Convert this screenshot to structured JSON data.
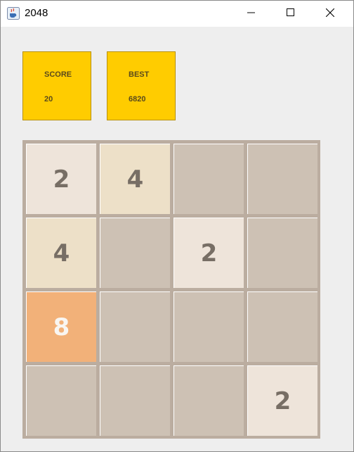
{
  "window": {
    "title": "2048"
  },
  "scores": [
    {
      "label": "SCORE",
      "value": "20"
    },
    {
      "label": "BEST",
      "value": "6820"
    }
  ],
  "board": {
    "rows": 4,
    "cols": 4,
    "tiles": [
      [
        "2",
        "4",
        "",
        ""
      ],
      [
        "4",
        "",
        "2",
        ""
      ],
      [
        "8",
        "",
        "",
        ""
      ],
      [
        "",
        "",
        "",
        "2"
      ]
    ]
  },
  "tile_colors": {
    "empty": "#cdc1b4",
    "2": "#eee4da",
    "4": "#ede0c8",
    "8": "#f2b179"
  },
  "text_colors": {
    "dark": "#776e65",
    "light": "#f9f6f2"
  },
  "accent_colors": {
    "score_box": "#ffcc00",
    "board": "#bbada0"
  }
}
